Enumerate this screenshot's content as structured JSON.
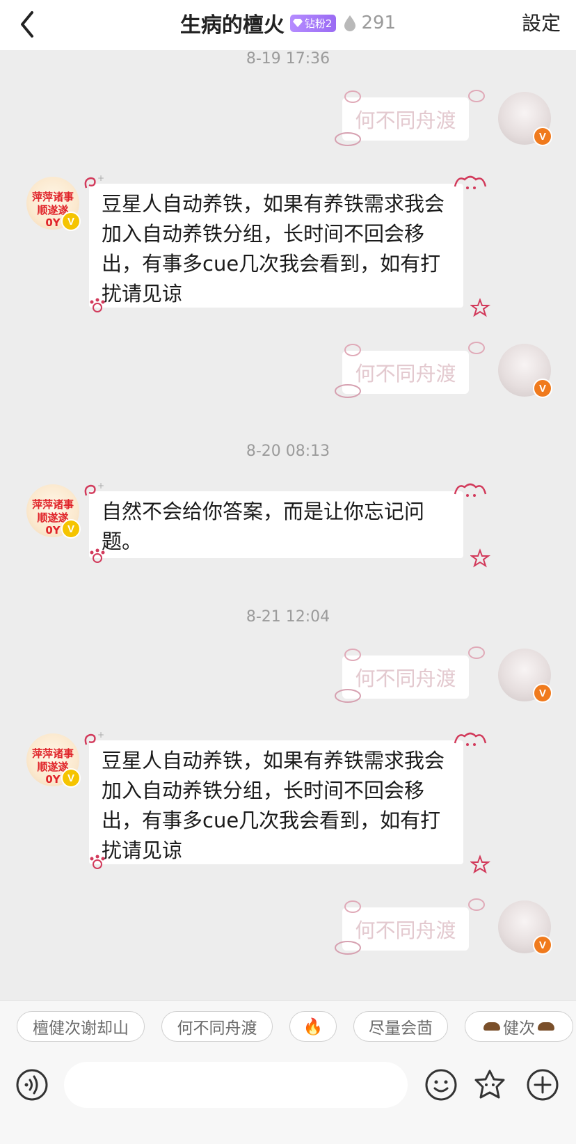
{
  "header": {
    "title": "生病的檀火",
    "badge_label": "钻粉2",
    "fan_count": "291",
    "settings_label": "設定"
  },
  "messages": {
    "time1": "8-19 17:36",
    "time2": "8-20 08:13",
    "time3": "8-21 12:04",
    "out_text": "何不同舟渡",
    "in_long": "豆星人自动养铁，如果有养铁需求我会加入自动养铁分组，长时间不回会移出，有事多cue几次我会看到，如有打扰请见谅",
    "in_short": "自然不会给你答案，而是让你忘记问题。",
    "left_avatar_line1": "萍萍诸事",
    "left_avatar_line2": "顺遂遂0Y"
  },
  "quick_replies": {
    "chip1": "檀健次谢却山",
    "chip2": "何不同舟渡",
    "chip3": "🔥",
    "chip4": "尽量会茴",
    "chip5": "健次"
  },
  "colors": {
    "accent_badge": "#a97cf9",
    "vip_left": "#f5c400",
    "vip_right": "#f07a1d",
    "deco": "#d23a5b"
  }
}
